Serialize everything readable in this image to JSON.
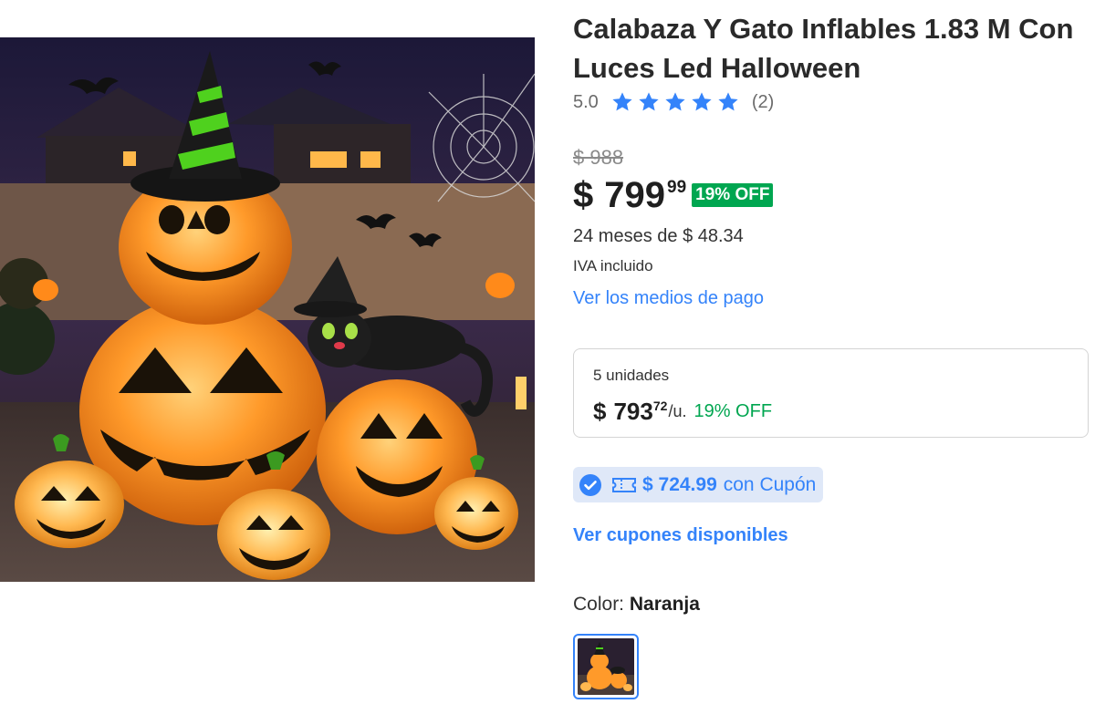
{
  "product": {
    "title": "Calabaza Y Gato Inflables 1.83 M Con Luces Led Halloween",
    "image_alt": "Inflable de Halloween: calabazas iluminadas con gato negro y sombrero de bruja"
  },
  "rating": {
    "value": "5.0",
    "stars": 5,
    "review_count": "(2)",
    "star_color": "#3483fa"
  },
  "price": {
    "original": "$ 988",
    "currency": "$",
    "amount": "799",
    "cents": "99",
    "discount_badge": "19% OFF"
  },
  "installments": "24 meses de $ 48.34",
  "tax_note": "IVA incluido",
  "payment_methods_link": "Ver los medios de pago",
  "bulk_offer": {
    "quantity": "5 unidades",
    "currency": "$",
    "amount": "793",
    "cents": "72",
    "unit": "/u.",
    "discount": "19% OFF"
  },
  "coupon": {
    "amount": "$ 724.99",
    "label": "con Cupón",
    "icons": [
      "check-circle-icon",
      "ticket-icon"
    ]
  },
  "coupons_link": "Ver cupones disponibles",
  "color_selector": {
    "label": "Color:",
    "value": "Naranja"
  },
  "colors": {
    "accent": "#3483fa",
    "success": "#00a650",
    "coupon_bg": "#dfe8f8"
  }
}
